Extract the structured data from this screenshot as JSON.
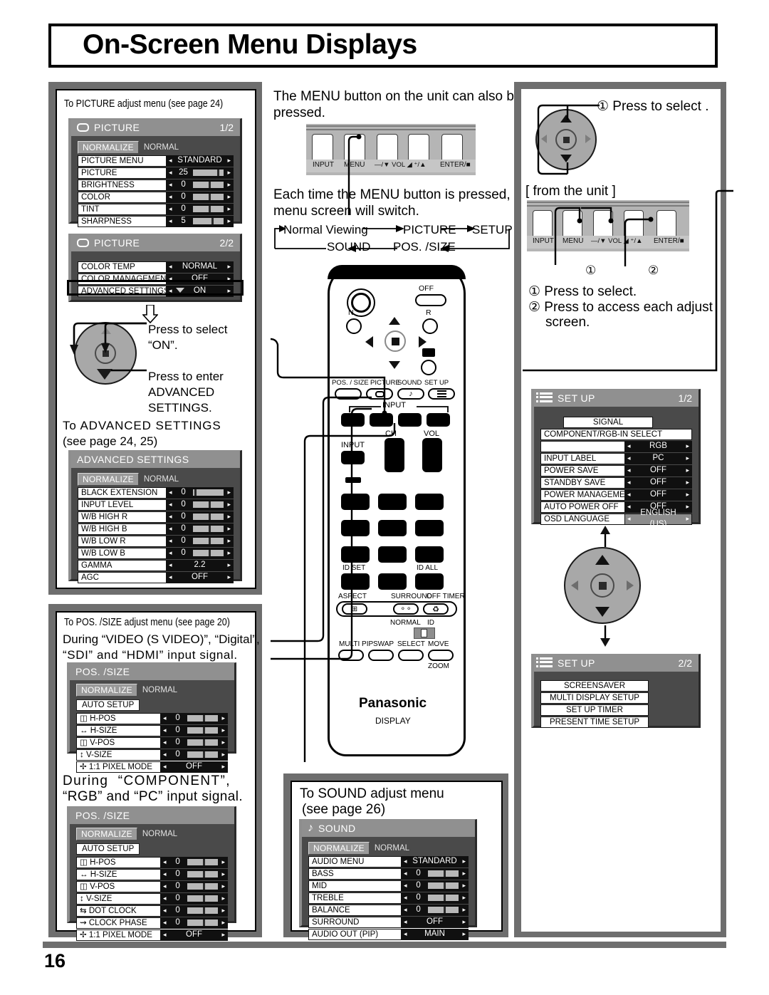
{
  "page": {
    "title": "On-Screen Menu Displays",
    "number": "16"
  },
  "left_column": {
    "picture_caption": "To PICTURE adjust menu (see page 24)",
    "picture_menu_1": {
      "icon": "picture-icon",
      "title": "PICTURE",
      "page": "1/2",
      "normalize_button": "NORMALIZE",
      "normalize_label": "NORMAL",
      "rows": [
        {
          "label": "PICTURE MENU",
          "value": "STANDARD",
          "type": "option"
        },
        {
          "label": "PICTURE",
          "value": "25",
          "type": "slider",
          "pos": 78
        },
        {
          "label": "BRIGHTNESS",
          "value": "0",
          "type": "slider",
          "pos": 50
        },
        {
          "label": "COLOR",
          "value": "0",
          "type": "slider",
          "pos": 50
        },
        {
          "label": "TINT",
          "value": "0",
          "type": "slider",
          "pos": 50
        },
        {
          "label": "SHARPNESS",
          "value": "5",
          "type": "slider",
          "pos": 60
        }
      ]
    },
    "picture_menu_2": {
      "icon": "picture-icon",
      "title": "PICTURE",
      "page": "2/2",
      "rows": [
        {
          "label": "COLOR TEMP",
          "value": "NORMAL",
          "type": "option"
        },
        {
          "label": "COLOR MANAGEMENT",
          "value": "OFF",
          "type": "option"
        },
        {
          "label": "ADVANCED SETTINGS",
          "value": "ON",
          "type": "option",
          "highlighted": true
        }
      ]
    },
    "wheel_note_1": "Press to select\n“ON”.",
    "wheel_note_2": "Press to enter\nADVANCED\nSETTINGS.",
    "advanced_caption_1": "To ADVANCED SETTINGS",
    "advanced_caption_2": "(see page 24, 25)",
    "advanced_menu": {
      "title": "ADVANCED SETTINGS",
      "normalize_button": "NORMALIZE",
      "normalize_label": "NORMAL",
      "rows": [
        {
          "label": "BLACK EXTENSION",
          "value": "0",
          "type": "slider",
          "pos": 8
        },
        {
          "label": "INPUT LEVEL",
          "value": "0",
          "type": "slider",
          "pos": 50
        },
        {
          "label": "W/B HIGH R",
          "value": "0",
          "type": "slider",
          "pos": 50
        },
        {
          "label": "W/B HIGH B",
          "value": "0",
          "type": "slider",
          "pos": 50
        },
        {
          "label": "W/B LOW R",
          "value": "0",
          "type": "slider",
          "pos": 50
        },
        {
          "label": "W/B LOW B",
          "value": "0",
          "type": "slider",
          "pos": 50
        },
        {
          "label": "GAMMA",
          "value": "2.2",
          "type": "option"
        },
        {
          "label": "AGC",
          "value": "OFF",
          "type": "option"
        }
      ]
    },
    "possize_caption": "To POS. /SIZE adjust menu (see page 20)",
    "possize_note_1": "During “VIDEO (S VIDEO)”, “Digital”,",
    "possize_note_2": "“SDI” and “HDMI” input signal.",
    "possize_menu_1": {
      "title": "POS. /SIZE",
      "normalize_button": "NORMALIZE",
      "normalize_label": "NORMAL",
      "auto_setup_button": "AUTO SETUP",
      "rows": [
        {
          "label": "H-POS",
          "icon": "h-pos-icon",
          "value": "0",
          "type": "slider",
          "pos": 50
        },
        {
          "label": "H-SIZE",
          "icon": "h-size-icon",
          "value": "0",
          "type": "slider",
          "pos": 50
        },
        {
          "label": "V-POS",
          "icon": "v-pos-icon",
          "value": "0",
          "type": "slider",
          "pos": 50
        },
        {
          "label": "V-SIZE",
          "icon": "v-size-icon",
          "value": "0",
          "type": "slider",
          "pos": 50
        },
        {
          "label": "1:1 PIXEL MODE",
          "icon": "pixel-mode-icon",
          "value": "OFF",
          "type": "option"
        }
      ]
    },
    "possize_note_3": "During  “COMPONENT”,",
    "possize_note_4": "“RGB” and “PC” input signal.",
    "possize_menu_2": {
      "title": "POS. /SIZE",
      "normalize_button": "NORMALIZE",
      "normalize_label": "NORMAL",
      "auto_setup_button": "AUTO SETUP",
      "rows": [
        {
          "label": "H-POS",
          "icon": "h-pos-icon",
          "value": "0",
          "type": "slider",
          "pos": 50
        },
        {
          "label": "H-SIZE",
          "icon": "h-size-icon",
          "value": "0",
          "type": "slider",
          "pos": 50
        },
        {
          "label": "V-POS",
          "icon": "v-pos-icon",
          "value": "0",
          "type": "slider",
          "pos": 50
        },
        {
          "label": "V-SIZE",
          "icon": "v-size-icon",
          "value": "0",
          "type": "slider",
          "pos": 50
        },
        {
          "label": "DOT CLOCK",
          "icon": "dot-clock-icon",
          "value": "0",
          "type": "slider",
          "pos": 50
        },
        {
          "label": "CLOCK PHASE",
          "icon": "clock-phase-icon",
          "value": "0",
          "type": "slider",
          "pos": 50
        },
        {
          "label": "1:1 PIXEL MODE",
          "icon": "pixel-mode-icon",
          "value": "OFF",
          "type": "option"
        }
      ]
    }
  },
  "center_column": {
    "menu_note_1": "The MENU button on the unit can also be",
    "menu_note_2": "pressed.",
    "unit_bar": {
      "buttons": [
        "INPUT",
        "MENU",
        "—/▼ VOL ◢ ⁺/▲",
        "ENTER/■"
      ]
    },
    "switch_note_1": "Each time the MENU button is pressed, the",
    "switch_note_2": "menu screen will switch.",
    "cycle_top": [
      "Normal Viewing",
      "PICTURE",
      "SETUP"
    ],
    "cycle_bottom": [
      "SOUND",
      "POS. /SIZE"
    ],
    "remote": {
      "power_label": "OFF",
      "n_label": "N",
      "r_label": "R",
      "mode_labels": [
        "POS. / SIZE",
        "PICTURE",
        "SOUND",
        "SET UP"
      ],
      "input_label": "INPUT",
      "input_btn_label": "INPUT",
      "ch_label": "CH",
      "vol_label": "VOL",
      "id_set_label": "ID SET",
      "id_all_label": "ID ALL",
      "aspect_label": "ASPECT",
      "surround_label": "SURROUND",
      "off_timer_label": "OFF TIMER",
      "normal_label": "NORMAL",
      "id_label": "ID",
      "multi_pip_label": "MULTI PIP",
      "swap_label": "SWAP",
      "select_label": "SELECT",
      "move_label": "MOVE",
      "zoom_label": "ZOOM",
      "brand": "Panasonic",
      "brand_sub": "DISPLAY"
    },
    "sound_caption_1": "To SOUND adjust menu",
    "sound_caption_2": "(see page 26)",
    "sound_menu": {
      "icon": "music-note-icon",
      "title": "SOUND",
      "normalize_button": "NORMALIZE",
      "normalize_label": "NORMAL",
      "rows": [
        {
          "label": "AUDIO MENU",
          "value": "STANDARD",
          "type": "option"
        },
        {
          "label": "BASS",
          "value": "0",
          "type": "slider",
          "pos": 50
        },
        {
          "label": "MID",
          "value": "0",
          "type": "slider",
          "pos": 50
        },
        {
          "label": "TREBLE",
          "value": "0",
          "type": "slider",
          "pos": 50
        },
        {
          "label": "BALANCE",
          "value": "0",
          "type": "slider",
          "pos": 50
        },
        {
          "label": "SURROUND",
          "value": "OFF",
          "type": "option"
        },
        {
          "label": "AUDIO OUT (PIP)",
          "value": "MAIN",
          "type": "option"
        }
      ]
    }
  },
  "right_column": {
    "press_to_select_top": "① Press to select .",
    "from_the_unit": "[ from the unit ]",
    "unit_bar": {
      "buttons": [
        "INPUT",
        "MENU",
        "—/▼ VOL ◢ ⁺/▲",
        "ENTER/■"
      ]
    },
    "callout_1": "①",
    "callout_2": "②",
    "step_1": "① Press to select.",
    "step_2": "② Press to access each adjust",
    "step_2b": "screen.",
    "setup_menu_1": {
      "icon": "list-icon",
      "title": "SET UP",
      "page": "1/2",
      "signal_button": "SIGNAL",
      "component_label": "COMPONENT/RGB-IN SELECT",
      "rows": [
        {
          "label": "",
          "value": "RGB",
          "type": "option"
        },
        {
          "label": "INPUT LABEL",
          "value": "PC",
          "type": "option"
        },
        {
          "label": "POWER SAVE",
          "value": "OFF",
          "type": "option"
        },
        {
          "label": "STANDBY SAVE",
          "value": "OFF",
          "type": "option"
        },
        {
          "label": "POWER MANAGEMENT",
          "value": "OFF",
          "type": "option"
        },
        {
          "label": "AUTO POWER OFF",
          "value": "OFF",
          "type": "option"
        },
        {
          "label": "OSD LANGUAGE",
          "value": "ENGLISH (US)",
          "type": "option",
          "highlighted": true
        }
      ]
    },
    "setup_menu_2": {
      "icon": "list-icon",
      "title": "SET UP",
      "page": "2/2",
      "items": [
        "SCREENSAVER",
        "MULTI DISPLAY SETUP",
        "SET UP TIMER",
        "PRESENT TIME SETUP"
      ]
    }
  }
}
